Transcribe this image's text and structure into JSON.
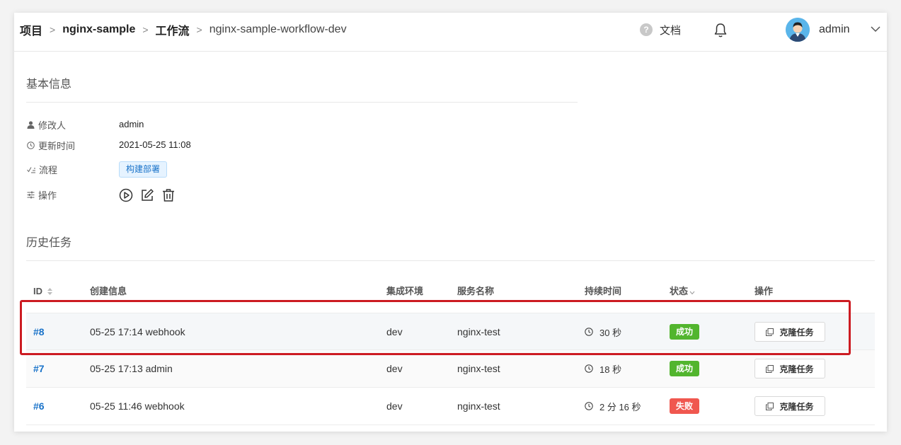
{
  "header": {
    "breadcrumb": [
      "项目",
      "nginx-sample",
      "工作流",
      "nginx-sample-workflow-dev"
    ],
    "separator": ">",
    "docs_label": "文档",
    "user_name": "admin"
  },
  "basic_info": {
    "title": "基本信息",
    "modifier_label": "修改人",
    "modifier_value": "admin",
    "updated_label": "更新时间",
    "updated_value": "2021-05-25 11:08",
    "flow_label": "流程",
    "flow_tag": "构建部署",
    "ops_label": "操作",
    "ops_icons": [
      "play-icon",
      "edit-icon",
      "trash-icon"
    ]
  },
  "history": {
    "title": "历史任务",
    "columns": [
      "ID",
      "创建信息",
      "集成环境",
      "服务名称",
      "持续时间",
      "状态",
      "操作"
    ],
    "rows": [
      {
        "id": "#8",
        "created": "05-25 17:14 webhook",
        "env": "dev",
        "service": "nginx-test",
        "duration": "30 秒",
        "status": "成功",
        "action": "克隆任务"
      },
      {
        "id": "#7",
        "created": "05-25 17:13 admin",
        "env": "dev",
        "service": "nginx-test",
        "duration": "18 秒",
        "status": "成功",
        "action": "克隆任务"
      },
      {
        "id": "#6",
        "created": "05-25 11:46 webhook",
        "env": "dev",
        "service": "nginx-test",
        "duration": "2 分 16 秒",
        "status": "失败",
        "action": "克隆任务"
      }
    ]
  },
  "colors": {
    "link": "#1a73c9",
    "success": "#52b52e",
    "failure": "#f0574f",
    "highlight": "#cc1b22"
  }
}
